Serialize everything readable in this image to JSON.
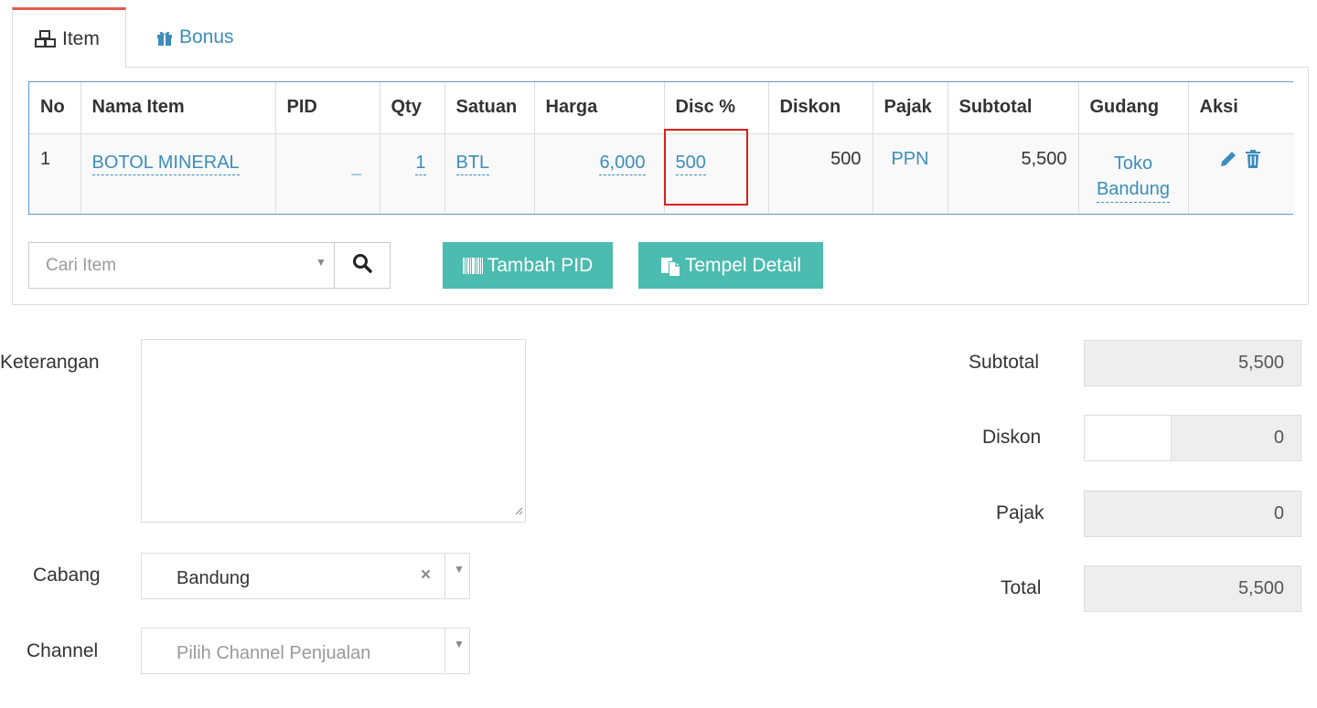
{
  "tabs": {
    "item_label": "Item",
    "bonus_label": "Bonus"
  },
  "table": {
    "headers": [
      "No",
      "Nama Item",
      "PID",
      "Qty",
      "Satuan",
      "Harga",
      "Disc %",
      "Diskon",
      "Pajak",
      "Subtotal",
      "Gudang",
      "Aksi"
    ],
    "rows": [
      {
        "no": "1",
        "nama_item": "BOTOL MINERAL",
        "pid": "----",
        "qty": "1",
        "satuan": "BTL",
        "harga": "6,000",
        "disc_pct": "500",
        "diskon": "500",
        "pajak": "PPN",
        "subtotal": "5,500",
        "gudang_line1": "Toko",
        "gudang_line2": "Bandung"
      }
    ]
  },
  "search": {
    "placeholder": "Cari Item"
  },
  "buttons": {
    "tambah_pid": "Tambah PID",
    "tempel_detail": "Tempel Detail"
  },
  "form": {
    "keterangan_label": "Keterangan",
    "cabang_label": "Cabang",
    "cabang_value": "Bandung",
    "channel_label": "Channel",
    "channel_placeholder": "Pilih Channel Penjualan"
  },
  "totals": {
    "subtotal_label": "Subtotal",
    "subtotal_value": "5,500",
    "diskon_label": "Diskon",
    "diskon_value": "0",
    "pajak_label": "Pajak",
    "pajak_value": "0",
    "total_label": "Total",
    "total_value": "5,500"
  },
  "colors": {
    "accent_tab": "#e9574f",
    "link": "#3c8dbc",
    "button": "#4cbbb0",
    "highlight": "#d9201c"
  }
}
